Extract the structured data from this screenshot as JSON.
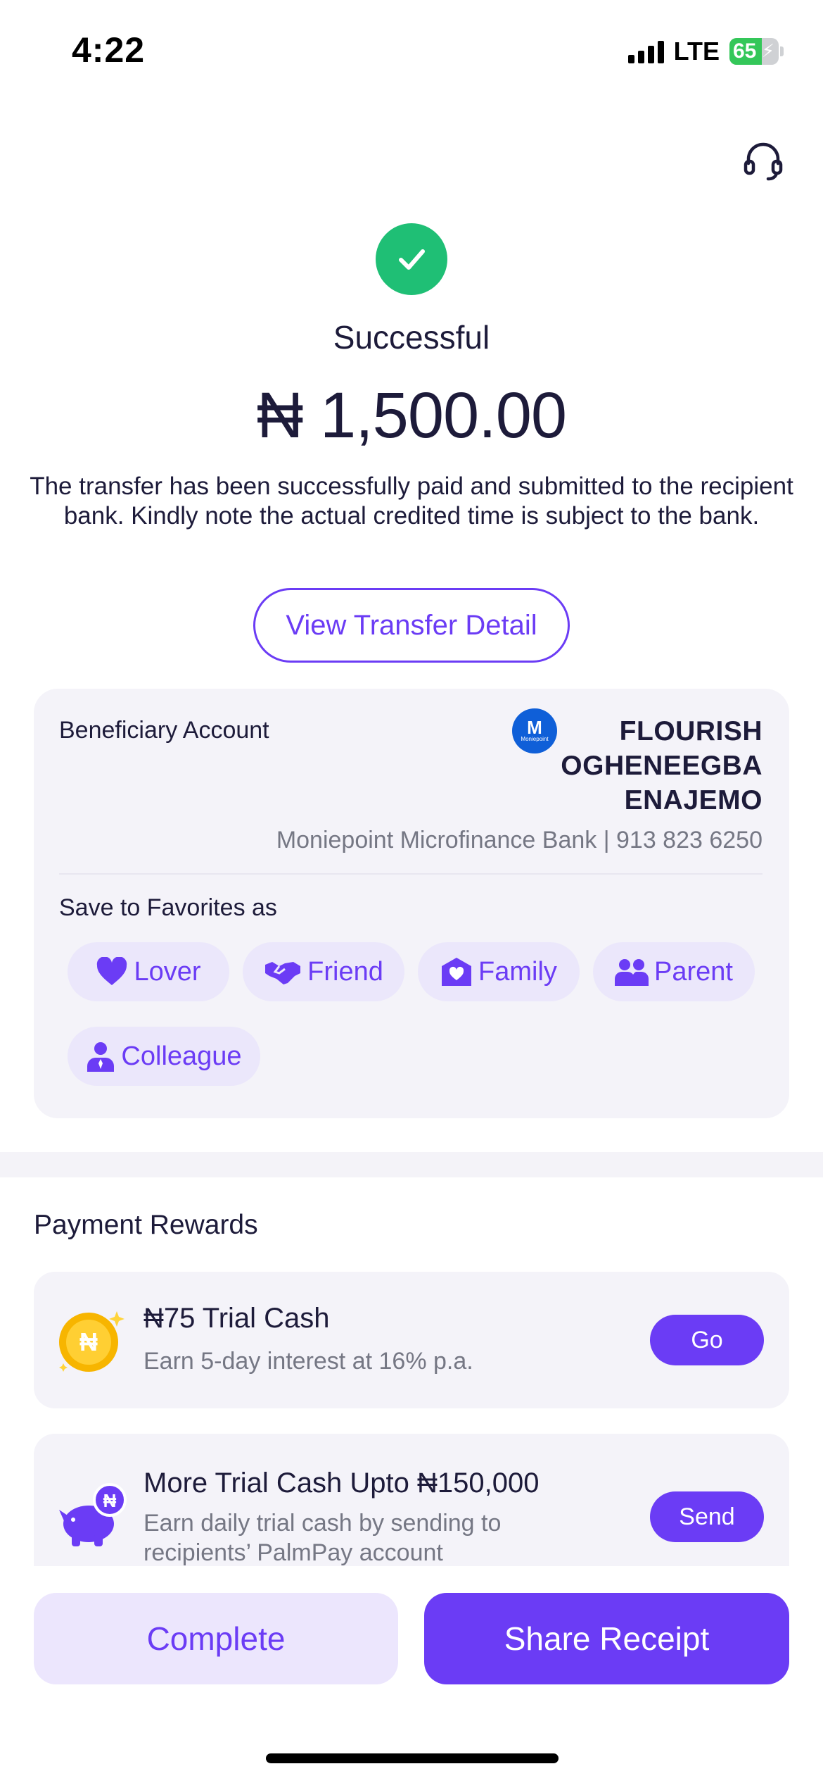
{
  "status_bar": {
    "time": "4:22",
    "network": "LTE",
    "battery_percent": "65",
    "battery_level": 0.65
  },
  "header": {
    "support_icon": "headset-icon"
  },
  "result": {
    "status_icon": "check-circle-icon",
    "title": "Successful",
    "amount": "₦ 1,500.00",
    "message": "The transfer has been successfully paid and submitted to the recipient bank. Kindly note the actual credited time is subject to the bank.",
    "view_detail_label": "View Transfer Detail"
  },
  "beneficiary": {
    "label": "Beneficiary Account",
    "bank_logo_letter": "M",
    "bank_logo_text": "Moniepoint",
    "name": "FLOURISH OGHENEEGBA ENAJEMO",
    "bank_and_account": "Moniepoint Microfinance Bank | 913 823 6250",
    "favorites_label": "Save to Favorites as",
    "favorites": [
      {
        "label": "Lover",
        "icon": "heart-icon"
      },
      {
        "label": "Friend",
        "icon": "handshake-icon"
      },
      {
        "label": "Family",
        "icon": "home-heart-icon"
      },
      {
        "label": "Parent",
        "icon": "people-icon"
      },
      {
        "label": "Colleague",
        "icon": "person-tie-icon"
      }
    ]
  },
  "rewards": {
    "title": "Payment Rewards",
    "items": [
      {
        "title": "₦75 Trial Cash",
        "subtitle": "Earn 5-day interest at 16% p.a.",
        "button": "Go",
        "icon": "naira-coin-icon"
      },
      {
        "title": "More Trial Cash Upto ₦150,000",
        "subtitle": "Earn daily trial cash by sending to recipients’ PalmPay account",
        "button": "Send",
        "icon": "piggy-bank-icon"
      }
    ]
  },
  "footer": {
    "complete_label": "Complete",
    "share_label": "Share Receipt"
  },
  "colors": {
    "accent": "#6b3cf5",
    "success": "#1fbf75",
    "card_bg": "#f4f3f9"
  }
}
